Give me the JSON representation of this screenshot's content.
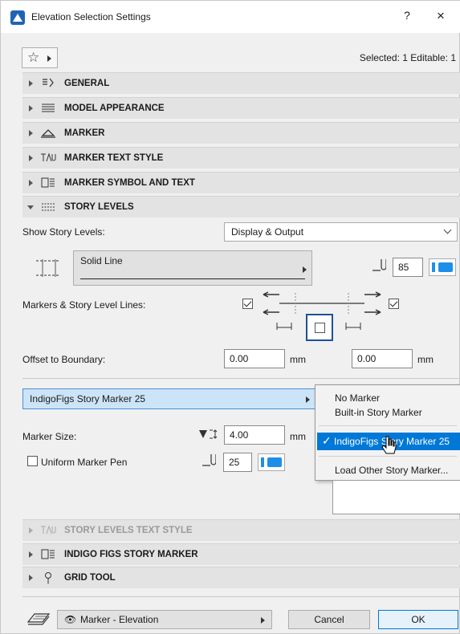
{
  "window": {
    "title": "Elevation Selection Settings",
    "help": "?",
    "close": "×"
  },
  "header": {
    "selected_info": "Selected: 1 Editable: 1"
  },
  "sections": {
    "general": "GENERAL",
    "model_appearance": "MODEL APPEARANCE",
    "marker": "MARKER",
    "marker_text_style": "MARKER TEXT STYLE",
    "marker_symbol_text": "MARKER SYMBOL AND TEXT",
    "story_levels": "STORY LEVELS",
    "story_levels_text_style": "STORY LEVELS TEXT STYLE",
    "indigo_figs": "INDIGO FIGS STORY MARKER",
    "grid_tool": "GRID TOOL"
  },
  "story_levels": {
    "show_label": "Show Story Levels:",
    "show_value": "Display & Output",
    "line_type": "Solid Line",
    "pen_number": "85",
    "markers_label": "Markers & Story Level Lines:",
    "offset_label": "Offset to Boundary:",
    "offset_left": "0.00",
    "offset_right": "0.00",
    "unit": "mm"
  },
  "marker_settings": {
    "marker_name": "IndigoFigs Story Marker 25",
    "size_label": "Marker Size:",
    "size_value": "4.00",
    "size_unit": "mm",
    "uniform_pen_label": "Uniform Marker Pen",
    "pen_value": "25"
  },
  "popup": {
    "items": [
      "No Marker",
      "Built-in Story Marker",
      "IndigoFigs Story Marker 25",
      "Load Other Story Marker..."
    ],
    "check": "✓"
  },
  "footer": {
    "view_layer": "Marker - Elevation",
    "cancel": "Cancel",
    "ok": "OK"
  },
  "colors": {
    "accent": "#0078d7",
    "pen_blue": "#1e8fe8",
    "selection_bg": "#cce4f7"
  }
}
